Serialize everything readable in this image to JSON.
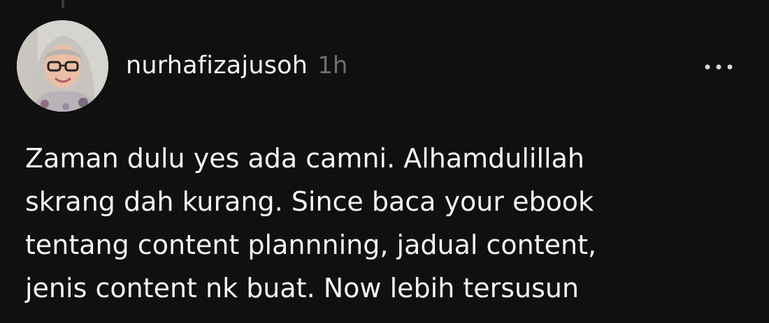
{
  "post": {
    "author": {
      "username": "nurhafizajusoh",
      "avatar": "avatar-photo"
    },
    "timestamp": "1h",
    "more_icon": "more-horizontal-icon",
    "body_lines": [
      "Zaman dulu yes ada camni. Alhamdulillah",
      "skrang dah kurang. Since baca your ebook",
      "tentang content plannning, jadual content,",
      "jenis content nk buat. Now lebih tersusun"
    ]
  },
  "colors": {
    "background": "#101010",
    "primary_text": "#f3f5f7",
    "secondary_text": "#6f6f6f"
  }
}
